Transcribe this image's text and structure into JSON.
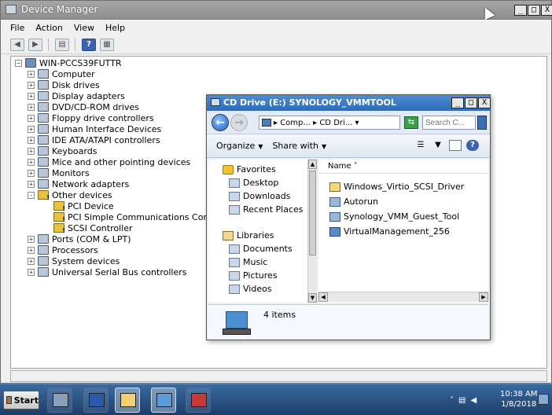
{
  "device_manager": {
    "title": "Device Manager",
    "menu": [
      "File",
      "Action",
      "View",
      "Help"
    ],
    "computer_name": "WIN-PCCS39FUTTR",
    "categories": [
      {
        "label": "Computer",
        "expander": "+"
      },
      {
        "label": "Disk drives",
        "expander": "+"
      },
      {
        "label": "Display adapters",
        "expander": "+"
      },
      {
        "label": "DVD/CD-ROM drives",
        "expander": "+"
      },
      {
        "label": "Floppy drive controllers",
        "expander": "+"
      },
      {
        "label": "Human Interface Devices",
        "expander": "+"
      },
      {
        "label": "IDE ATA/ATAPI controllers",
        "expander": "+"
      },
      {
        "label": "Keyboards",
        "expander": "+"
      },
      {
        "label": "Mice and other pointing devices",
        "expander": "+"
      },
      {
        "label": "Monitors",
        "expander": "+"
      },
      {
        "label": "Network adapters",
        "expander": "+"
      },
      {
        "label": "Other devices",
        "expander": "-"
      },
      {
        "label": "Ports (COM & LPT)",
        "expander": "+"
      },
      {
        "label": "Processors",
        "expander": "+"
      },
      {
        "label": "System devices",
        "expander": "+"
      },
      {
        "label": "Universal Serial Bus controllers",
        "expander": "+"
      }
    ],
    "other_devices_children": [
      "PCI Device",
      "PCI Simple Communications Controller",
      "SCSI Controller"
    ]
  },
  "explorer": {
    "title": "CD Drive (E:) SYNOLOGY_VMMTOOL",
    "address": {
      "seg1": "Comp...",
      "seg2": "CD Dri..."
    },
    "search_placeholder": "Search C...",
    "commands": {
      "organize": "Organize",
      "share": "Share with"
    },
    "nav": {
      "favorites_header": "Favorites",
      "favorites": [
        "Desktop",
        "Downloads",
        "Recent Places"
      ],
      "libraries_header": "Libraries",
      "libraries": [
        "Documents",
        "Music",
        "Pictures",
        "Videos"
      ]
    },
    "column_name": "Name",
    "files": [
      {
        "name": "Windows_Virtio_SCSI_Driver",
        "kind": "folder"
      },
      {
        "name": "Autorun",
        "kind": "exe"
      },
      {
        "name": "Synology_VMM_Guest_Tool",
        "kind": "exe"
      },
      {
        "name": "VirtualManagement_256",
        "kind": "msi"
      }
    ],
    "item_count": "4 items"
  },
  "caption_buttons": [
    "_",
    "□",
    "X"
  ],
  "taskbar": {
    "start_label": "Start",
    "clock_time": "10:38 AM",
    "clock_date": "1/8/2018",
    "tray_expand": "˄"
  }
}
